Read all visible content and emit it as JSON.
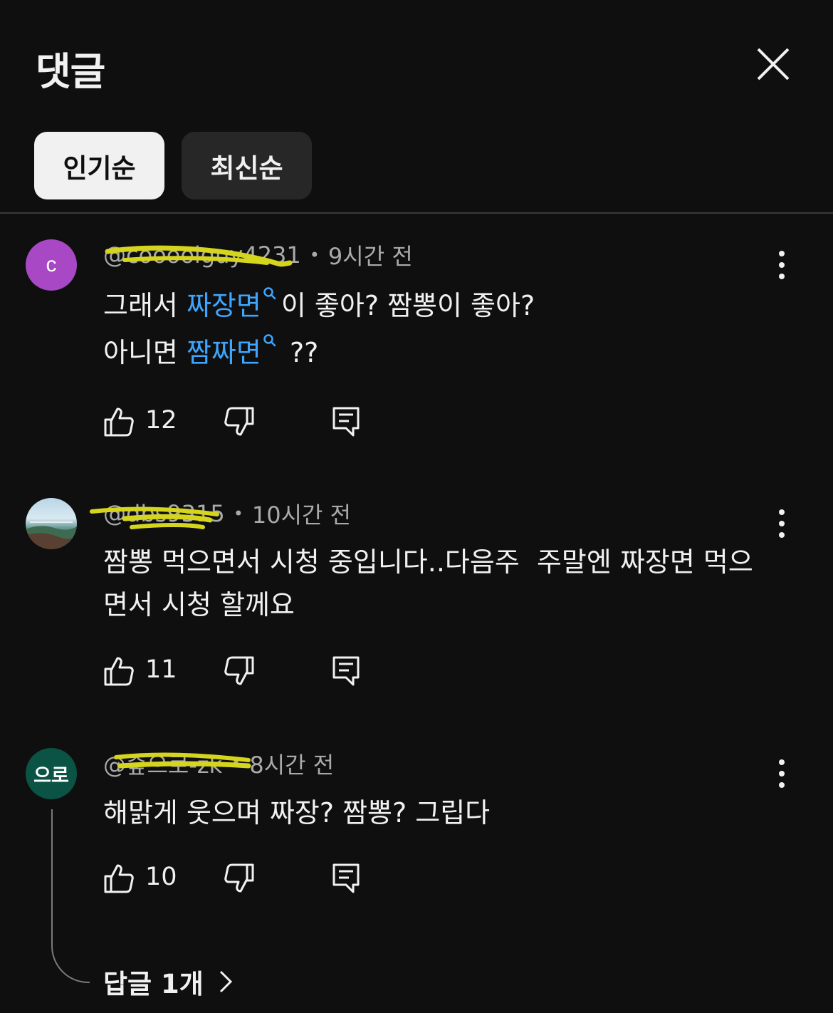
{
  "header": {
    "title": "댓글",
    "close_icon": "close-icon"
  },
  "sort_chips": [
    {
      "label": "인기순",
      "selected": true
    },
    {
      "label": "최신순",
      "selected": false
    }
  ],
  "colors": {
    "background": "#0f0f0f",
    "link": "#3ea6ff",
    "avatar_c": "#a948c4",
    "avatar_euro": "#0b5345",
    "highlighter": "#d6d51d"
  },
  "comments": [
    {
      "avatar_text": "c",
      "handle": "@coooolguy4231",
      "time": "9시간 전",
      "lines": [
        [
          {
            "text": "그래서 "
          },
          {
            "text": "짜장면",
            "link": true
          },
          {
            "text": "이 좋아? 짬뽕이 좋아?"
          }
        ],
        [
          {
            "text": "아니면 "
          },
          {
            "text": "짬짜면",
            "link": true
          },
          {
            "text": " ??"
          }
        ]
      ],
      "likes": "12"
    },
    {
      "avatar_text": "",
      "handle": "@dbs9315",
      "time": "10시간 전",
      "lines": [
        [
          {
            "text": "짬뽕 먹으면서 시청 중입니다..다음주  주말엔 짜장면 먹으"
          }
        ],
        [
          {
            "text": "면서 시청 할께요"
          }
        ]
      ],
      "likes": "11"
    },
    {
      "avatar_text": "으로",
      "handle": "@숲으로-zk",
      "time": "8시간 전",
      "lines": [
        [
          {
            "text": "해맑게 웃으며 짜장? 짬뽕? 그립다"
          }
        ]
      ],
      "likes": "10"
    }
  ],
  "replies_label": "답글 1개",
  "icons": {
    "like": "thumbs-up-icon",
    "dislike": "thumbs-down-icon",
    "reply": "reply-icon",
    "more": "more-vert-icon",
    "chevron": "chevron-right-icon",
    "search": "search-icon"
  }
}
